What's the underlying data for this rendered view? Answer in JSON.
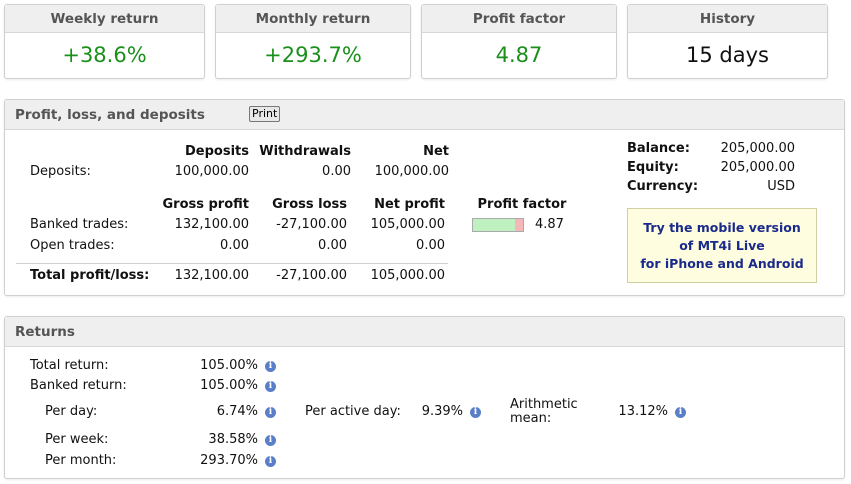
{
  "stats": [
    {
      "label": "Weekly return",
      "value": "+38.6%",
      "color": "#1a8f1a"
    },
    {
      "label": "Monthly return",
      "value": "+293.7%",
      "color": "#1a8f1a"
    },
    {
      "label": "Profit factor",
      "value": "4.87",
      "color": "#1a8f1a"
    },
    {
      "label": "History",
      "value": "15 days",
      "color": "#111111"
    }
  ],
  "pl": {
    "title": "Profit, loss, and deposits",
    "print_label": "Print",
    "dep_headers": [
      "Deposits",
      "Withdrawals",
      "Net"
    ],
    "deposits_label": "Deposits:",
    "deposits_row": [
      "100,000.00",
      "0.00",
      "100,000.00"
    ],
    "trade_headers": [
      "Gross profit",
      "Gross loss",
      "Net profit",
      "Profit factor"
    ],
    "banked_label": "Banked trades:",
    "banked_row": [
      "132,100.00",
      "-27,100.00",
      "105,000.00"
    ],
    "banked_pf": "4.87",
    "banked_pf_ratio": 0.83,
    "open_label": "Open trades:",
    "open_row": [
      "0.00",
      "0.00",
      "0.00"
    ],
    "total_label": "Total profit/loss:",
    "total_row": [
      "132,100.00",
      "-27,100.00",
      "105,000.00"
    ],
    "balance_label": "Balance:",
    "balance": "205,000.00",
    "equity_label": "Equity:",
    "equity": "205,000.00",
    "currency_label": "Currency:",
    "currency": "USD",
    "promo": [
      "Try the mobile version",
      "of MT4i Live",
      "for iPhone and Android"
    ]
  },
  "returns": {
    "title": "Returns",
    "total_label": "Total return:",
    "total": "105.00%",
    "banked_label": "Banked return:",
    "banked": "105.00%",
    "per_day_label": "Per day:",
    "per_day": "6.74%",
    "per_active_day_label": "Per active day:",
    "per_active_day": "9.39%",
    "arith_label_1": "Arithmetic",
    "arith_label_2": "mean:",
    "arith": "13.12%",
    "per_week_label": "Per week:",
    "per_week": "38.58%",
    "per_month_label": "Per month:",
    "per_month": "293.70%",
    "info_glyph": "i"
  }
}
